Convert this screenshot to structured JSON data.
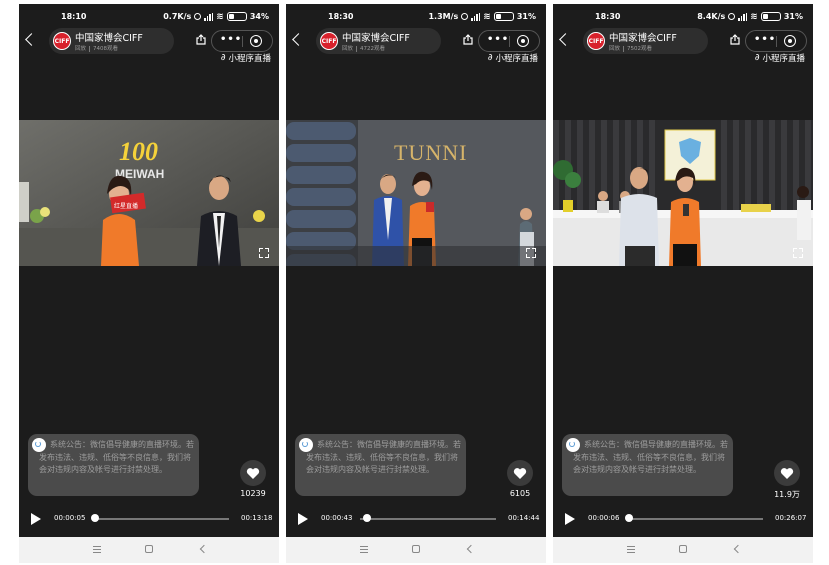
{
  "screens": [
    {
      "status": {
        "time": "18:10",
        "speed": "0.7K/s",
        "battery": "34%"
      },
      "channel": {
        "name": "中国家博会CIFF",
        "logo_text": "CIFF",
        "status": "回放",
        "viewers": "7408观看"
      },
      "mini_program_live": "小程序直播",
      "video": {
        "sign_text": "MEIWAH",
        "sign_number": "100",
        "mic_text": "红星直播"
      },
      "notice": "系统公告：微信倡导健康的直播环境。若发布违法、违规、低俗等不良信息，我们将会对违规内容及帐号进行封禁处理。",
      "likes": "10239",
      "player": {
        "current": "00:00:05",
        "total": "00:13:18",
        "progress": 0.006
      }
    },
    {
      "status": {
        "time": "18:30",
        "speed": "1.3M/s",
        "battery": "31%"
      },
      "channel": {
        "name": "中国家博会CIFF",
        "logo_text": "CIFF",
        "status": "回放",
        "viewers": "4722观看"
      },
      "mini_program_live": "小程序直播",
      "video": {
        "sign_text": "TUNNI"
      },
      "notice": "系统公告：微信倡导健康的直播环境。若发布违法、违规、低俗等不良信息，我们将会对违规内容及帐号进行封禁处理。",
      "likes": "6105",
      "player": {
        "current": "00:00:43",
        "total": "00:14:44",
        "progress": 0.049
      }
    },
    {
      "status": {
        "time": "18:30",
        "speed": "8.4K/s",
        "battery": "31%"
      },
      "channel": {
        "name": "中国家博会CIFF",
        "logo_text": "CIFF",
        "status": "回放",
        "viewers": "7502观看"
      },
      "mini_program_live": "小程序直播",
      "video": {
        "sign_text": ""
      },
      "notice": "系统公告：微信倡导健康的直播环境。若发布违法、违规、低俗等不良信息，我们将会对违规内容及帐号进行封禁处理。",
      "likes": "11.9万",
      "player": {
        "current": "00:00:06",
        "total": "00:26:07",
        "progress": 0.004
      }
    }
  ],
  "colors": {
    "app_bg": "#1c1c1c",
    "logo_red": "#d8212c",
    "notice_bg": "#4b4b4b",
    "shirt_orange": "#f07a2a"
  }
}
